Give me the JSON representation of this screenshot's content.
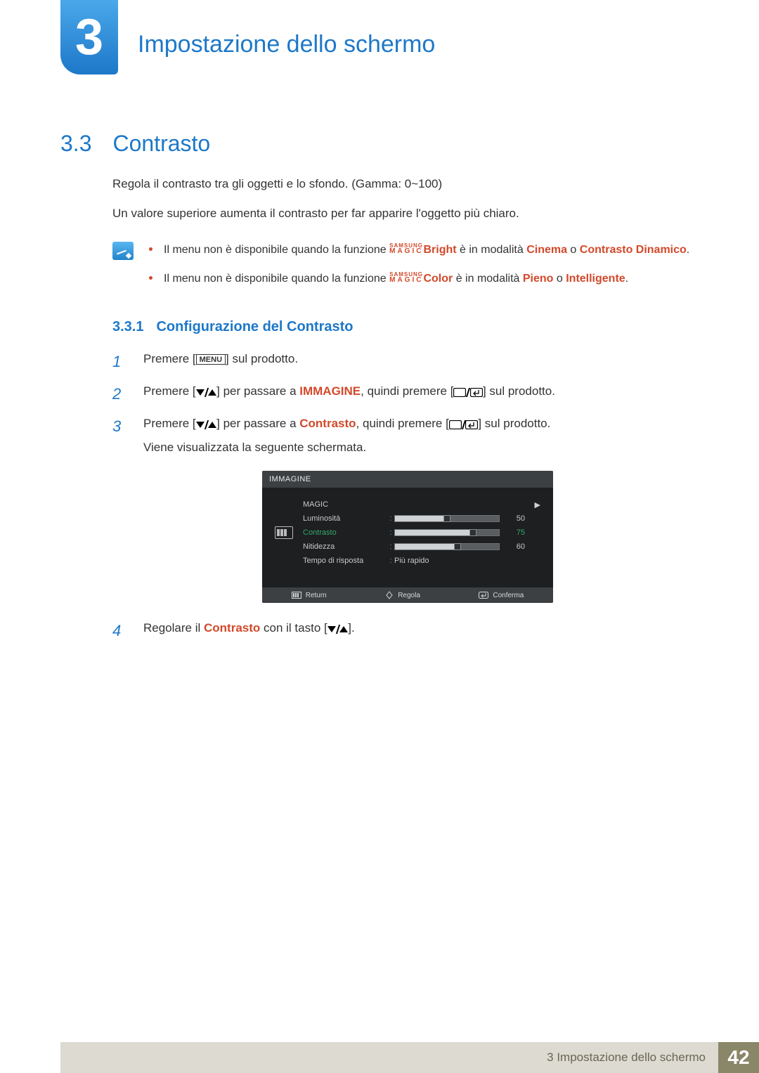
{
  "chapter": {
    "number": "3",
    "title": "Impostazione dello schermo"
  },
  "section": {
    "number": "3.3",
    "title": "Contrasto"
  },
  "intro": {
    "p1": "Regola il contrasto tra gli oggetti e lo sfondo. (Gamma: 0~100)",
    "p2": "Un valore superiore aumenta il contrasto per far apparire l'oggetto più chiaro."
  },
  "magic_label": {
    "samsung": "SAMSUNG",
    "magic": "MAGIC"
  },
  "notes": [
    {
      "pre": "Il menu non è disponibile quando la funzione ",
      "suffix": "Bright",
      "mid1": " è in modalità ",
      "hl1": "Cinema",
      "mid2": " o ",
      "hl2": "Contrasto Dinamico",
      "post": "."
    },
    {
      "pre": "Il menu non è disponibile quando la funzione ",
      "suffix": "Color",
      "mid1": " è in modalità ",
      "hl1": "Pieno",
      "mid2": " o ",
      "hl2": "Intelligente",
      "post": "."
    }
  ],
  "subsection": {
    "number": "3.3.1",
    "title": "Configurazione del Contrasto"
  },
  "steps": {
    "s1": {
      "n": "1",
      "a": "Premere [",
      "key": "MENU",
      "b": "] sul prodotto."
    },
    "s2": {
      "n": "2",
      "a": "Premere [",
      "b": "] per passare a ",
      "hl": "IMMAGINE",
      "c": ", quindi premere [",
      "d": "] sul prodotto."
    },
    "s3": {
      "n": "3",
      "a": "Premere [",
      "b": "] per passare a ",
      "hl": "Contrasto",
      "c": ", quindi premere [",
      "d": "] sul prodotto.",
      "sub": "Viene visualizzata la seguente schermata."
    },
    "s4": {
      "n": "4",
      "a": "Regolare il ",
      "hl": "Contrasto",
      "b": " con il tasto [",
      "c": "]."
    }
  },
  "osd": {
    "title": "IMMAGINE",
    "rows": {
      "magic": "MAGIC",
      "lum": {
        "label": "Luminosità",
        "value": "50",
        "pct": 50
      },
      "con": {
        "label": "Contrasto",
        "value": "75",
        "pct": 75
      },
      "nit": {
        "label": "Nitidezza",
        "value": "60",
        "pct": 60
      },
      "tempo": {
        "label": "Tempo di risposta",
        "value": "Più rapido"
      }
    },
    "footer": {
      "return": "Return",
      "adjust": "Regola",
      "confirm": "Conferma"
    }
  },
  "footer": {
    "text": "3 Impostazione dello schermo",
    "page": "42"
  }
}
